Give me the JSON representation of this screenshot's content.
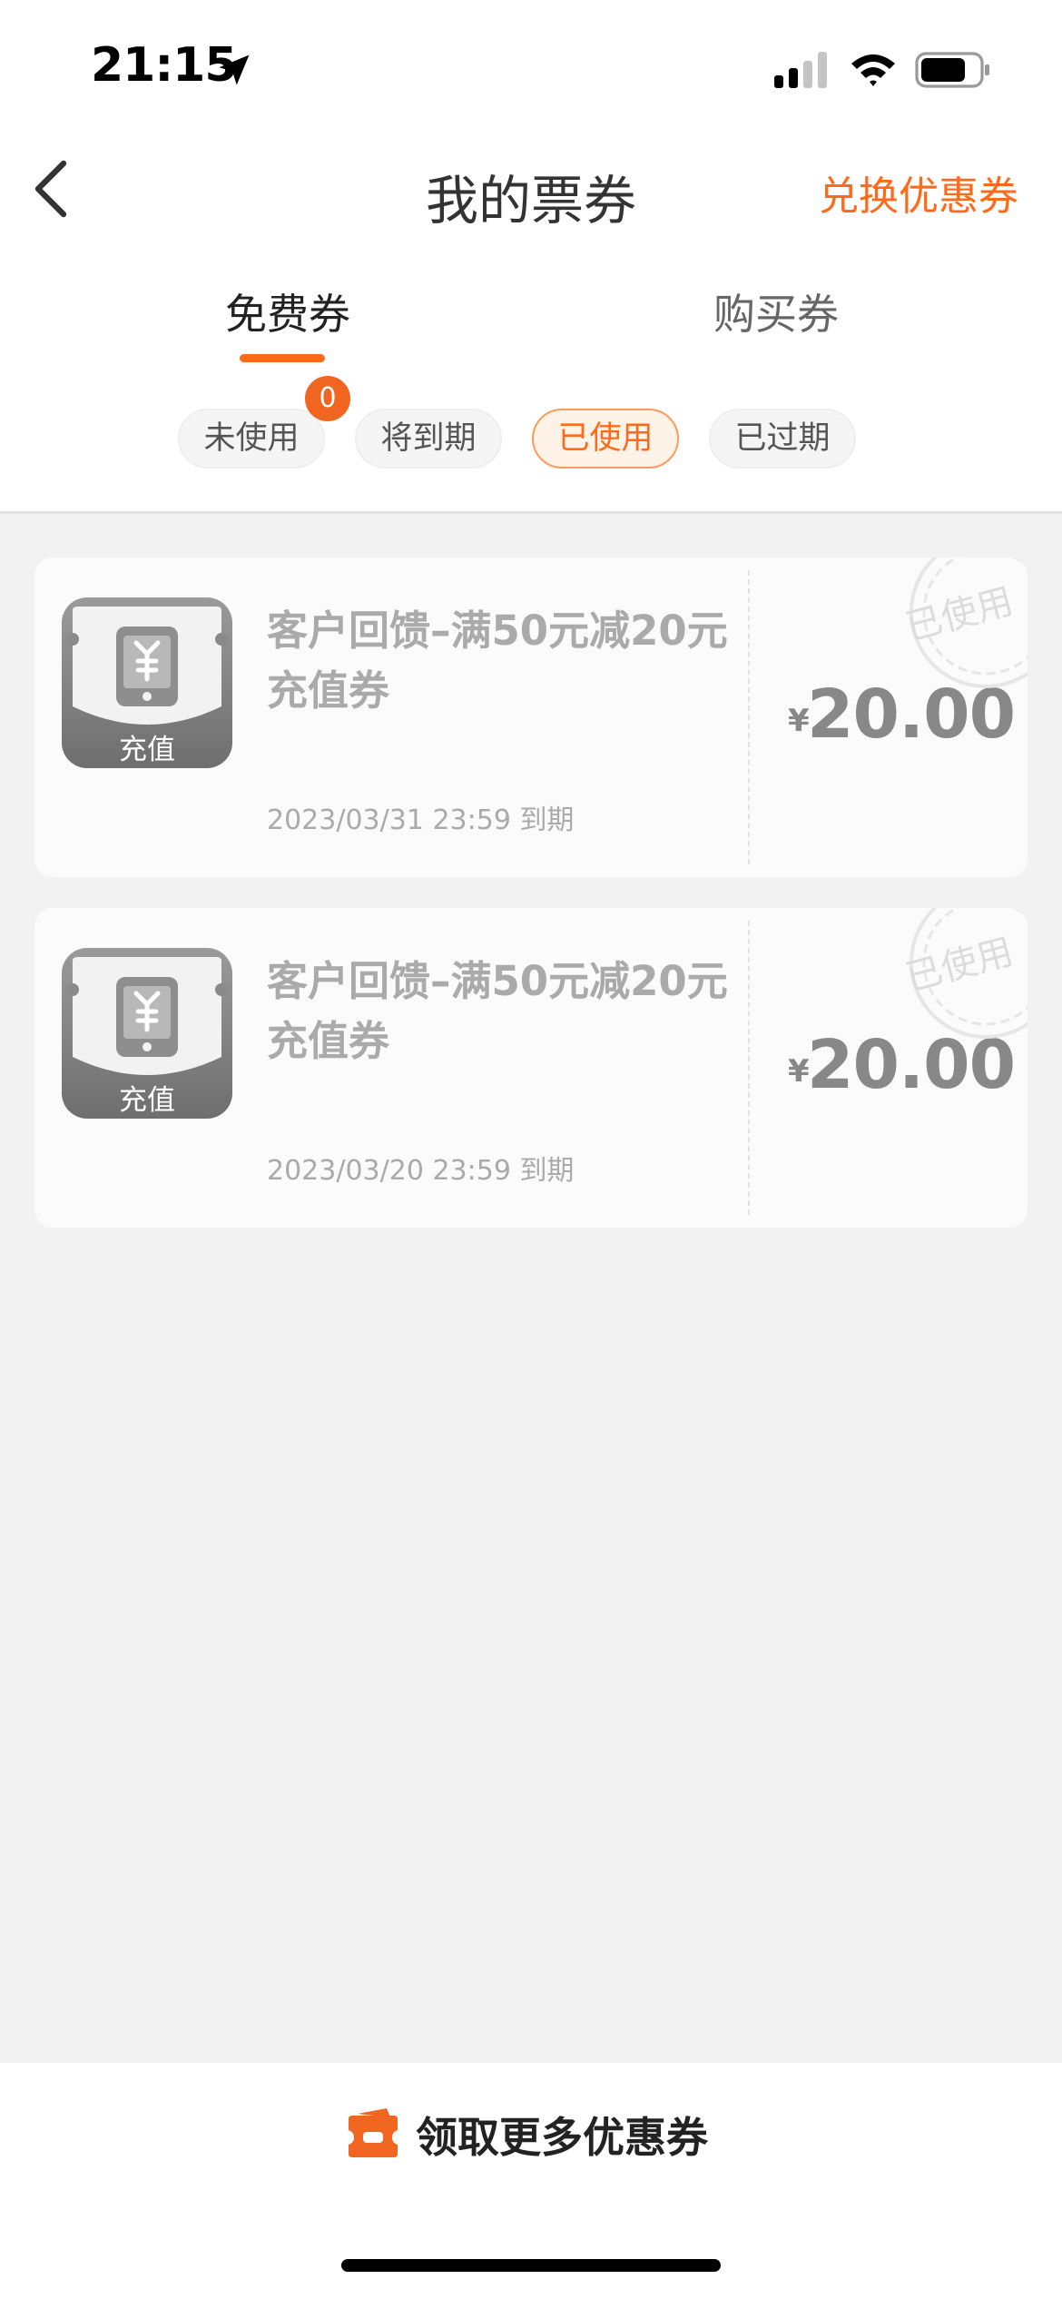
{
  "status_bar": {
    "time": "21:15"
  },
  "header": {
    "title": "我的票券",
    "action": "兑换优惠券"
  },
  "tabs": [
    {
      "label": "免费券",
      "active": true
    },
    {
      "label": "购买券",
      "active": false
    }
  ],
  "filters": [
    {
      "label": "未使用",
      "active": false
    },
    {
      "label": "将到期",
      "active": false
    },
    {
      "label": "已使用",
      "active": true
    },
    {
      "label": "已过期",
      "active": false
    }
  ],
  "badge": {
    "count": "0"
  },
  "coupons": [
    {
      "icon_label": "充值",
      "title": "客户回馈–满50元减20元充值券",
      "date": "2023/03/31 23:59 到期",
      "currency": "¥",
      "amount": "20.00",
      "stamp": "已使用"
    },
    {
      "icon_label": "充值",
      "title": "客户回馈–满50元减20元充值券",
      "date": "2023/03/20 23:59 到期",
      "currency": "¥",
      "amount": "20.00",
      "stamp": "已使用"
    }
  ],
  "footer": {
    "label": "领取更多优惠券"
  },
  "colors": {
    "accent": "#ff6a1a",
    "background": "#f2f2f2",
    "card": "#fbfbfb",
    "muted_text": "#aaaaaa"
  },
  "icons": [
    "location-arrow-icon",
    "signal-icon",
    "wifi-icon",
    "battery-icon",
    "back-chevron-icon",
    "phone-recharge-icon",
    "used-stamp-icon",
    "coupon-ticket-icon"
  ]
}
